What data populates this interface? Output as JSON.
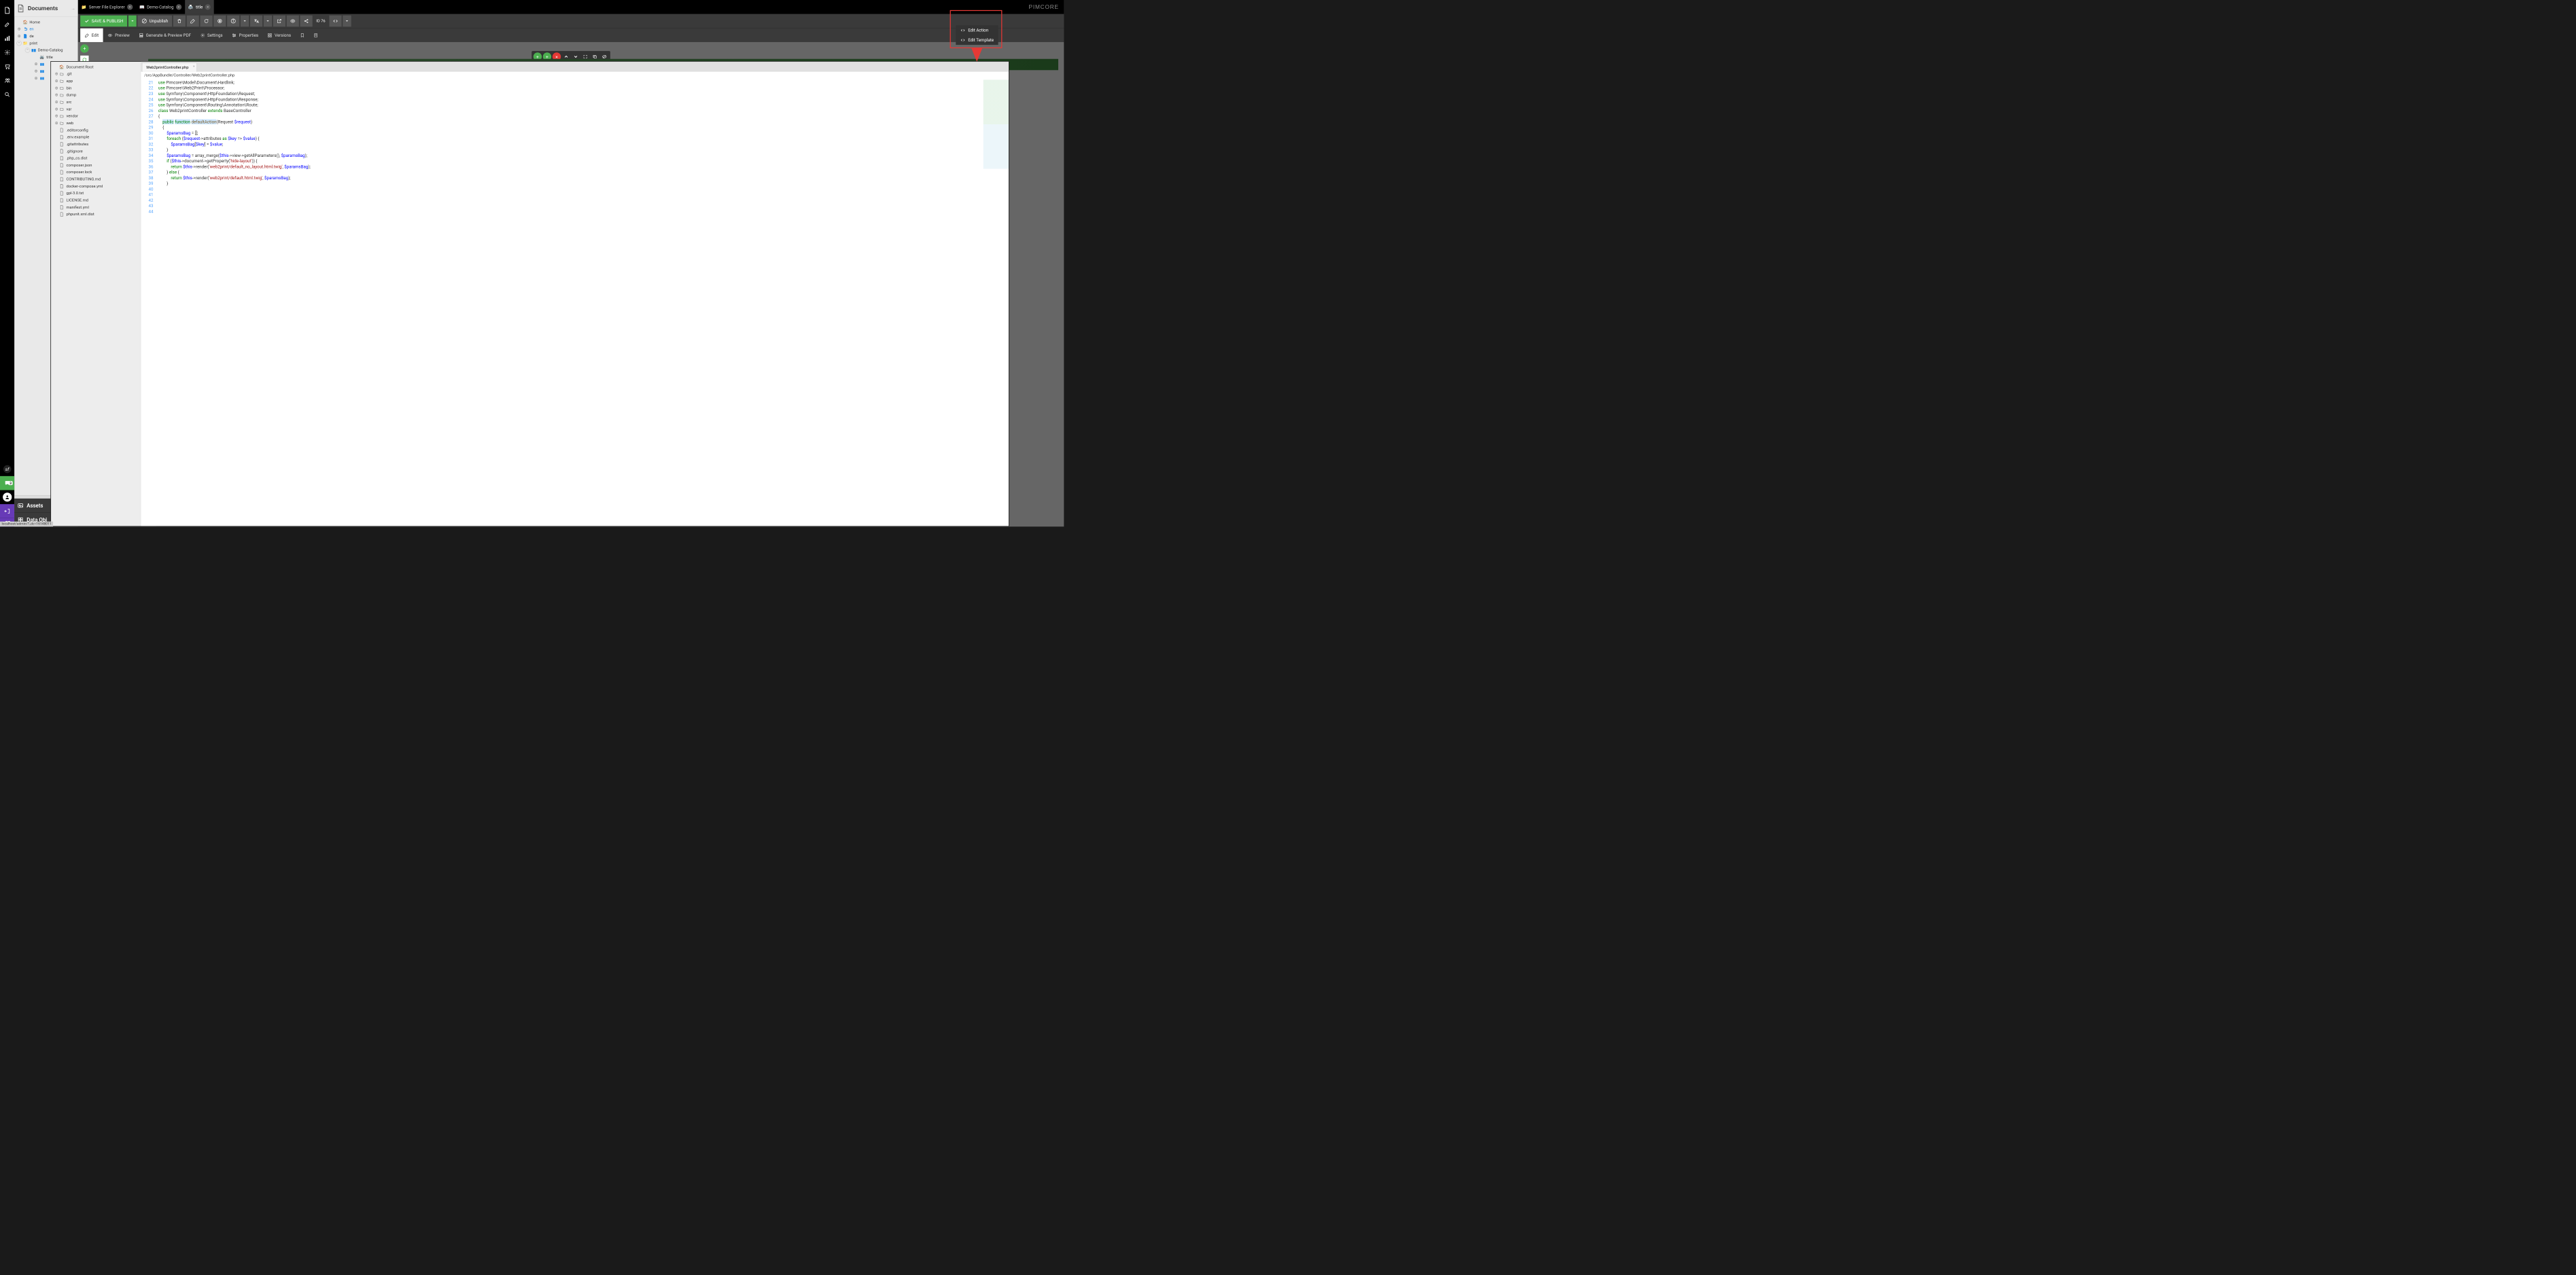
{
  "brand": "PIMCORE",
  "statusbar": "localhost/admin/?_dc=16148011",
  "docs_panel": {
    "title": "Documents",
    "assets_title": "Assets",
    "dataobj_title": "Data Obj",
    "tree": {
      "home": "Home",
      "en": "en",
      "de": "de",
      "print": "print",
      "demo_catalog": "Demo-Catalog",
      "title": "title"
    }
  },
  "tabs": {
    "sfe": "Server File Explorer",
    "demo": "Demo-Catalog",
    "title": "title"
  },
  "toolbar": {
    "save": "SAVE & PUBLISH",
    "unpublish": "Unpublish",
    "id": "ID 76"
  },
  "subtabs": {
    "edit": "Edit",
    "preview": "Preview",
    "genpdf": "Generate & Preview PDF",
    "settings": "Settings",
    "properties": "Properties",
    "versions": "Versions"
  },
  "dropdown": {
    "edit_action": "Edit Action",
    "edit_template": "Edit Template"
  },
  "chat_badge": "3",
  "file_explorer": {
    "root": "Document Root",
    "dirs": [
      ".git",
      "app",
      "bin",
      "dump",
      "src",
      "var",
      "vendor",
      "web"
    ],
    "files": [
      ".editorconfig",
      ".env.example",
      ".gitattributes",
      ".gitignore",
      ".php_cs.dist",
      "composer.json",
      "composer.lock",
      "CONTRIBUTING.md",
      "docker-compose.yml",
      "gpl-3.0.txt",
      "LICENSE.md",
      "manifest.yml",
      "phpunit.xml.dist"
    ],
    "tab": "Web2printController.php",
    "path": "/src/AppBundle/Controller/Web2printController.php",
    "code_lines": [
      {
        "n": 21,
        "raw": "use Pimcore\\Model\\Document\\Hardlink;"
      },
      {
        "n": 22,
        "raw": "use Pimcore\\Web2Print\\Processor;"
      },
      {
        "n": 23,
        "raw": "use Symfony\\Component\\HttpFoundation\\Request;"
      },
      {
        "n": 24,
        "raw": "use Symfony\\Component\\HttpFoundation\\Response;"
      },
      {
        "n": 25,
        "raw": "use Symfony\\Component\\Routing\\Annotation\\Route;"
      },
      {
        "n": 26,
        "raw": ""
      },
      {
        "n": 27,
        "raw": "class Web2printController extends BaseController"
      },
      {
        "n": 28,
        "raw": "{"
      },
      {
        "n": 29,
        "raw": "    public function defaultAction(Request $request)"
      },
      {
        "n": 30,
        "raw": "    {"
      },
      {
        "n": 31,
        "raw": "        $paramsBag = [];"
      },
      {
        "n": 32,
        "raw": ""
      },
      {
        "n": 33,
        "raw": "        foreach ($request->attributes as $key => $value) {"
      },
      {
        "n": 34,
        "raw": "            $paramsBag[$key] = $value;"
      },
      {
        "n": 35,
        "raw": "        }"
      },
      {
        "n": 36,
        "raw": ""
      },
      {
        "n": 37,
        "raw": "        $paramsBag = array_merge($this->view->getAllParameters(), $paramsBag);"
      },
      {
        "n": 38,
        "raw": ""
      },
      {
        "n": 39,
        "raw": "        if ($this->document->getProperty('hide-layout')) {"
      },
      {
        "n": 40,
        "raw": "            return $this->render('web2print/default_no_layout.html.twig', $paramsBag);"
      },
      {
        "n": 41,
        "raw": "        } else {"
      },
      {
        "n": 42,
        "raw": "            return $this->render('web2print/default.html.twig', $paramsBag);"
      },
      {
        "n": 43,
        "raw": "        }"
      },
      {
        "n": 44,
        "raw": ""
      }
    ]
  }
}
